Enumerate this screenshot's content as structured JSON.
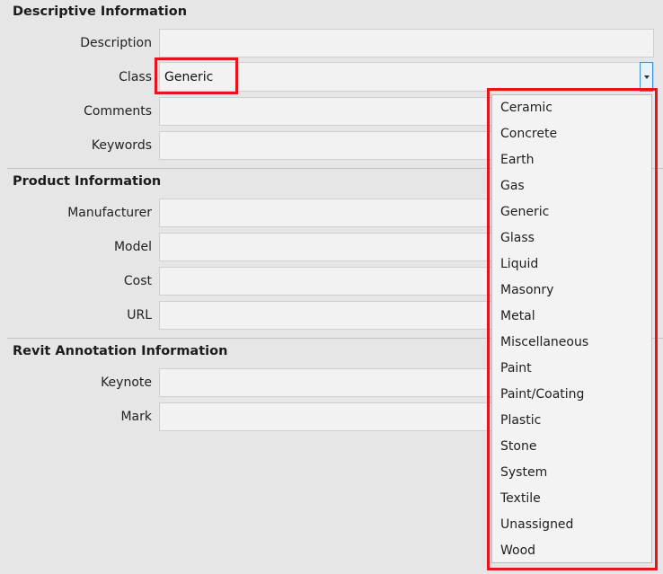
{
  "descriptive": {
    "title": "Descriptive Information",
    "description_label": "Description",
    "description_value": "",
    "class_label": "Class",
    "class_value": "Generic",
    "comments_label": "Comments",
    "comments_value": "",
    "keywords_label": "Keywords",
    "keywords_value": ""
  },
  "product": {
    "title": "Product Information",
    "manufacturer_label": "Manufacturer",
    "manufacturer_value": "",
    "model_label": "Model",
    "model_value": "",
    "cost_label": "Cost",
    "cost_value": "",
    "url_label": "URL",
    "url_value": ""
  },
  "revit": {
    "title": "Revit Annotation Information",
    "keynote_label": "Keynote",
    "keynote_value": "",
    "mark_label": "Mark",
    "mark_value": ""
  },
  "class_dropdown": {
    "options": [
      "Ceramic",
      "Concrete",
      "Earth",
      "Gas",
      "Generic",
      "Glass",
      "Liquid",
      "Masonry",
      "Metal",
      "Miscellaneous",
      "Paint",
      "Paint/Coating",
      "Plastic",
      "Stone",
      "System",
      "Textile",
      "Unassigned",
      "Wood"
    ]
  },
  "icons": {
    "dropdown_arrow": "chevron-down-icon"
  },
  "colors": {
    "highlight": "#e8131b",
    "focus_border": "#3c8ddb",
    "background": "#e6e6e6"
  }
}
